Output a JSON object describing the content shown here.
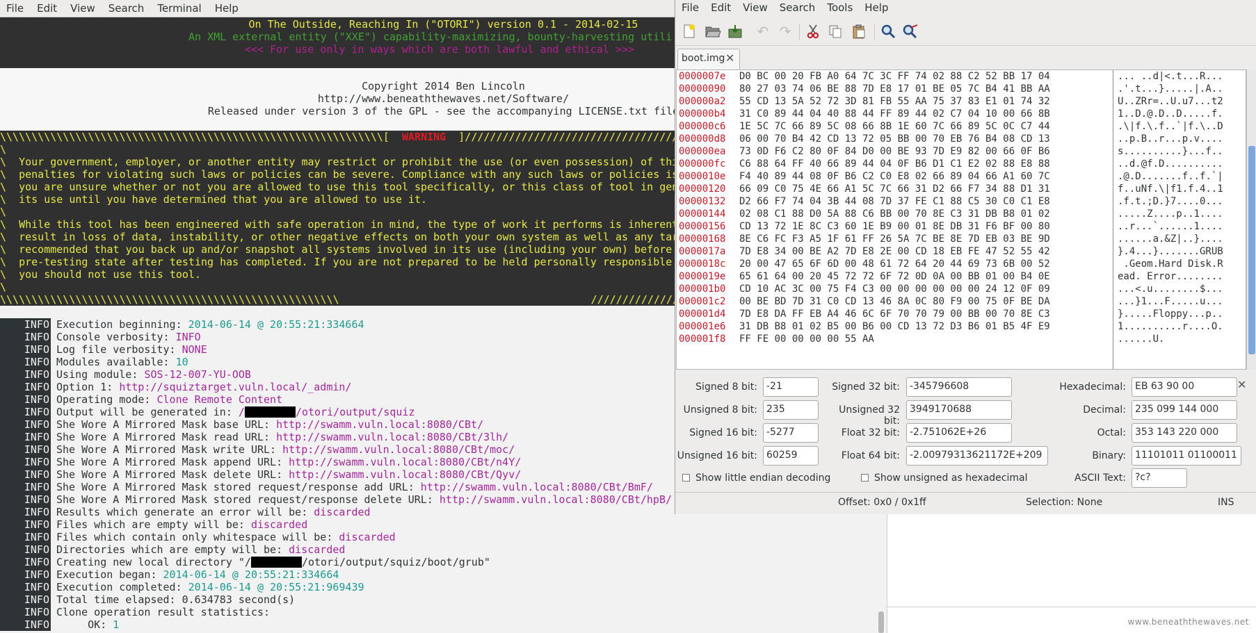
{
  "terminal": {
    "menu": [
      "File",
      "Edit",
      "View",
      "Search",
      "Terminal",
      "Help"
    ],
    "banner": [
      "On The Outside, Reaching In (\"OTORI\") version 0.1 - 2014-02-15",
      "An XML external entity (\"XXE\") capability-maximizing, bounty-harvesting utili",
      "<<< For use only in ways which are both lawful and ethical >>>"
    ],
    "copyright": [
      "Copyright 2014 Ben Lincoln",
      "http://www.beneaththewaves.net/Software/",
      "Released under version 3 of the GPL - see the accompanying LICENSE.txt file"
    ],
    "warning_fill_left": "\\\\\\\\\\\\\\\\\\\\\\\\\\\\\\\\\\\\\\\\\\\\\\\\\\\\\\\\\\\\\\\\\\\\\\\\\\\\\\\\\\\\\\\\\\\\\\\\\\\\\\\\\\\\\\\\\\\\\\\\\\[",
    "warning_title": "WARNING",
    "warning_fill_right": "]//////////////////////////////////////////////////////////",
    "warning_body": [
      "\\",
      "\\  Your government, employer, or another entity may restrict or prohibit the use (or even possession) of thi",
      "\\  penalties for violating such laws or policies can be severe. Compliance with any such laws or policies is",
      "\\  you are unsure whether or not you are allowed to use this tool specifically, or this class of tool in gen",
      "\\  its use until you have determined that you are allowed to use it.",
      "\\",
      "\\  While this tool has been engineered with safe operation in mind, the type of work it performs is inherent",
      "\\  result in loss of data, instability, or other negative effects on both your own system as well as any tar",
      "\\  recommended that you back up and/or snapshot all systems involved in its use (including your own) before",
      "\\  pre-testing state after testing has completed. If you are not prepared to be held personally responsible",
      "\\  you should not use this tool.",
      "\\"
    ],
    "warning_footer_left": "\\\\\\\\\\\\\\\\\\\\\\\\\\\\\\\\\\\\\\\\\\\\\\\\\\\\\\\\\\\\\\\\\\\\\\\\\\\\\\\\\\\\\\\\\\\\\\\\\\\\\\\\\\\\",
    "warning_footer_right": "//////////////////",
    "log_tag": "INFO",
    "log": [
      {
        "text": "Execution beginning: ",
        "ts": "2014-06-14 @ 20:55:21:334664"
      },
      {
        "text": "Console verbosity: ",
        "val": "INFO"
      },
      {
        "text": "Log file verbosity: ",
        "val": "NONE"
      },
      {
        "text": "Modules available: ",
        "ts": "10"
      },
      {
        "text": "Using module: ",
        "val": "SOS-12-007-YU-OOB"
      },
      {
        "text": "Option 1: ",
        "val": "http://squiztarget.vuln.local/_admin/"
      },
      {
        "text": "Operating mode: ",
        "val": "Clone Remote Content"
      },
      {
        "text": "Output will be generated in: ",
        "val": "/",
        "redact": true,
        "val2": "/otori/output/squiz"
      },
      {
        "text": "She Wore A Mirrored Mask base URL: ",
        "val": "http://swamm.vuln.local:8080/CBt/"
      },
      {
        "text": "She Wore A Mirrored Mask read URL: ",
        "val": "http://swamm.vuln.local:8080/CBt/3lh/"
      },
      {
        "text": "She Wore A Mirrored Mask write URL: ",
        "val": "http://swamm.vuln.local:8080/CBt/moc/"
      },
      {
        "text": "She Wore A Mirrored Mask append URL: ",
        "val": "http://swamm.vuln.local:8080/CBt/n4Y/"
      },
      {
        "text": "She Wore A Mirrored Mask delete URL: ",
        "val": "http://swamm.vuln.local:8080/CBt/Qyv/"
      },
      {
        "text": "She Wore A Mirrored Mask stored request/response add URL: ",
        "val": "http://swamm.vuln.local:8080/CBt/BmF/"
      },
      {
        "text": "She Wore A Mirrored Mask stored request/response delete URL: ",
        "val": "http://swamm.vuln.local:8080/CBt/hpB/"
      },
      {
        "text": "Results which generate an error will be: ",
        "val": "discarded"
      },
      {
        "text": "Files which are empty will be: ",
        "val": "discarded"
      },
      {
        "text": "Files which contain only whitespace will be: ",
        "val": "discarded"
      },
      {
        "text": "Directories which are empty will be: ",
        "val": "discarded"
      },
      {
        "text": "Creating new local directory \"/",
        "redact": true,
        "plain2": "/otori/output/squiz/boot/grub\""
      },
      {
        "text": "Execution began: ",
        "ts": "2014-06-14 @ 20:55:21:334664"
      },
      {
        "text": "Execution completed: ",
        "ts": "2014-06-14 @ 20:55:21:969439"
      },
      {
        "text": "Total time elapsed: 0.634783 second(s)"
      },
      {
        "text": "Clone operation result statistics:"
      },
      {
        "text": "     OK: ",
        "ts": "1"
      }
    ]
  },
  "ghex": {
    "menu": [
      "File",
      "Edit",
      "View",
      "Search",
      "Tools",
      "Help"
    ],
    "toolbar": [
      "new-file-icon",
      "open-icon",
      "save-icon",
      "undo-icon",
      "redo-icon",
      "cut-icon",
      "copy-icon",
      "paste-icon",
      "find-icon",
      "replace-icon"
    ],
    "tab_label": "boot.img",
    "hex_rows": [
      {
        "off": "0000007e",
        "bytes": "D0 BC 00 20 FB A0 64 7C 3C FF 74 02 88 C2 52 BB 17 04",
        "ascii": "... ..d|<.t...R..."
      },
      {
        "off": "00000090",
        "bytes": "80 27 03 74 06 BE 88 7D E8 17 01 BE 05 7C B4 41 BB AA",
        "ascii": ".'.t...}.....|.A.."
      },
      {
        "off": "000000a2",
        "bytes": "55 CD 13 5A 52 72 3D 81 FB 55 AA 75 37 83 E1 01 74 32",
        "ascii": "U..ZRr=..U.u7...t2"
      },
      {
        "off": "000000b4",
        "bytes": "31 C0 89 44 04 40 88 44 FF 89 44 02 C7 04 10 00 66 8B",
        "ascii": "1..D.@.D..D.....f."
      },
      {
        "off": "000000c6",
        "bytes": "1E 5C 7C 66 89 5C 08 66 8B 1E 60 7C 66 89 5C 0C C7 44",
        "ascii": ".\\|f.\\.f..`|f.\\..D"
      },
      {
        "off": "000000d8",
        "bytes": "06 00 70 B4 42 CD 13 72 05 BB 00 70 EB 76 B4 08 CD 13",
        "ascii": "..p.B..r...p.v...."
      },
      {
        "off": "000000ea",
        "bytes": "73 0D F6 C2 80 0F 84 D0 00 BE 93 7D E9 82 00 66 0F B6",
        "ascii": "s..........}...f.."
      },
      {
        "off": "000000fc",
        "bytes": "C6 88 64 FF 40 66 89 44 04 0F B6 D1 C1 E2 02 88 E8 88",
        "ascii": "..d.@f.D.........."
      },
      {
        "off": "0000010e",
        "bytes": "F4 40 89 44 08 0F B6 C2 C0 E8 02 66 89 04 66 A1 60 7C",
        "ascii": ".@.D.......f..f.`|"
      },
      {
        "off": "00000120",
        "bytes": "66 09 C0 75 4E 66 A1 5C 7C 66 31 D2 66 F7 34 88 D1 31",
        "ascii": "f..uNf.\\|f1.f.4..1"
      },
      {
        "off": "00000132",
        "bytes": "D2 66 F7 74 04 3B 44 08 7D 37 FE C1 88 C5 30 C0 C1 E8",
        "ascii": ".f.t.;D.}7....0..."
      },
      {
        "off": "00000144",
        "bytes": "02 08 C1 88 D0 5A 88 C6 BB 00 70 8E C3 31 DB B8 01 02",
        "ascii": ".....Z....p..1...."
      },
      {
        "off": "00000156",
        "bytes": "CD 13 72 1E 8C C3 60 1E B9 00 01 8E DB 31 F6 BF 00 80",
        "ascii": "..r...`......1...."
      },
      {
        "off": "00000168",
        "bytes": "8E C6 FC F3 A5 1F 61 FF 26 5A 7C BE 8E 7D EB 03 BE 9D",
        "ascii": "......a.&Z|..}...."
      },
      {
        "off": "0000017a",
        "bytes": "7D E8 34 00 BE A2 7D E8 2E 00 CD 18 EB FE 47 52 55 42",
        "ascii": "}.4...}.......GRUB"
      },
      {
        "off": "0000018c",
        "bytes": "20 00 47 65 6F 6D 00 48 61 72 64 20 44 69 73 6B 00 52",
        "ascii": " .Geom.Hard Disk.R"
      },
      {
        "off": "0000019e",
        "bytes": "65 61 64 00 20 45 72 72 6F 72 0D 0A 00 BB 01 00 B4 0E",
        "ascii": "ead. Error........"
      },
      {
        "off": "000001b0",
        "bytes": "CD 10 AC 3C 00 75 F4 C3 00 00 00 00 00 00 24 12 0F 09",
        "ascii": "...<.u........$..."
      },
      {
        "off": "000001c2",
        "bytes": "00 BE BD 7D 31 C0 CD 13 46 8A 0C 80 F9 00 75 0F BE DA",
        "ascii": "...}1...F.....u..."
      },
      {
        "off": "000001d4",
        "bytes": "7D E8 DA FF EB A4 46 6C 6F 70 70 79 00 BB 00 70 8E C3",
        "ascii": "}.....Floppy...p.."
      },
      {
        "off": "000001e6",
        "bytes": "31 DB B8 01 02 B5 00 B6 00 CD 13 72 D3 B6 01 B5 4F E9",
        "ascii": "1..........r....O."
      },
      {
        "off": "000001f8",
        "bytes": "FF FE 00 00 00 00 55 AA",
        "ascii": "......U."
      }
    ],
    "decoder": {
      "signed8_label": "Signed 8 bit:",
      "signed8": "-21",
      "unsigned8_label": "Unsigned 8 bit:",
      "unsigned8": "235",
      "signed16_label": "Signed 16 bit:",
      "signed16": "-5277",
      "unsigned16_label": "Unsigned 16 bit:",
      "unsigned16": "60259",
      "signed32_label": "Signed 32 bit:",
      "signed32": "-345796608",
      "unsigned32_label": "Unsigned 32 bit:",
      "unsigned32": "3949170688",
      "float32_label": "Float 32 bit:",
      "float32": "-2.751062E+26",
      "float64_label": "Float 64 bit:",
      "float64": "-2.00979313621172E+209",
      "hex_label": "Hexadecimal:",
      "hex": "EB 63 90 00",
      "dec_label": "Decimal:",
      "dec": "235 099 144 000",
      "oct_label": "Octal:",
      "oct": "353 143 220 000",
      "bin_label": "Binary:",
      "bin": "11101011 01100011",
      "ascii_label": "ASCII Text:",
      "ascii": "?c?",
      "little_endian_label": "Show little endian decoding",
      "unsigned_hex_label": "Show unsigned as hexadecimal"
    },
    "status": {
      "offset": "Offset: 0x0 / 0x1ff",
      "selection": "Selection: None",
      "mode": "INS"
    }
  },
  "watermark": "www.beneaththewaves.net"
}
